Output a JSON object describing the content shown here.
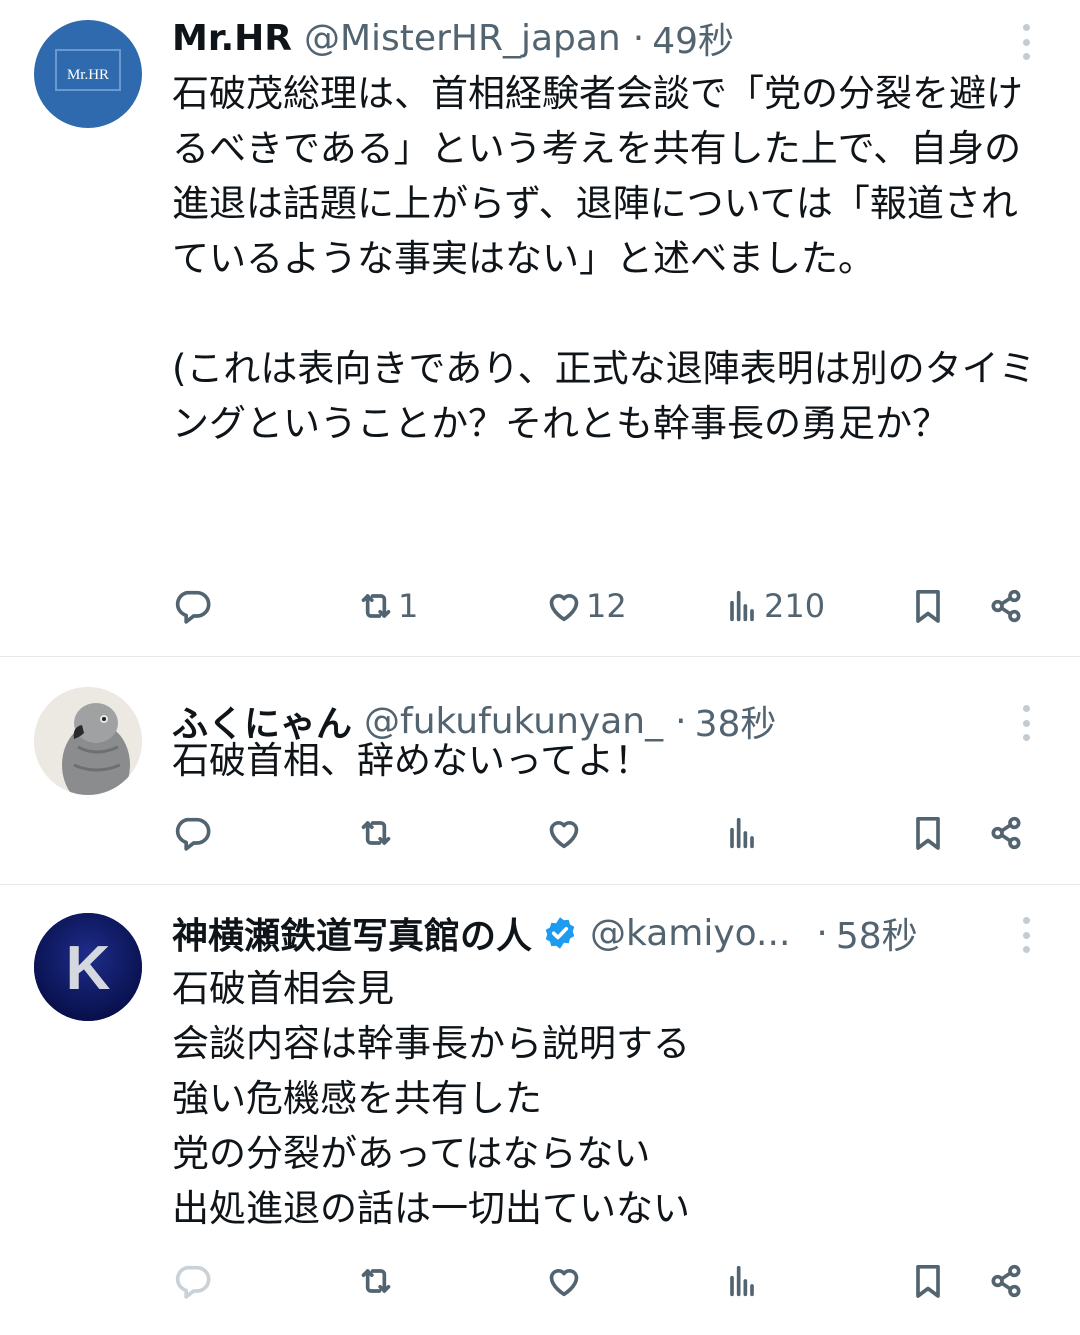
{
  "tweets": [
    {
      "avatar_text": "Mr.HR",
      "name": "Mr.HR",
      "handle": "@MisterHR_japan",
      "time": "49秒",
      "text": "石破茂総理は、首相経験者会談で「党の分裂を避けるべきである」という考えを共有した上で、自身の進退は話題に上がらず、退陣については「報道されているような事実はない」と述べました。\n\n(これは表向きであり、正式な退陣表明は別のタイミングということか？それとも幹事長の勇足か？",
      "retweets": "1",
      "likes": "12",
      "views": "210"
    },
    {
      "name": "ふくにゃん",
      "handle": "@fukufukunyan_",
      "time": "38秒",
      "text": "石破首相、辞めないってよ！",
      "retweets": "",
      "likes": "",
      "views": ""
    },
    {
      "avatar_text": "K",
      "name": "神横瀬鉄道写真館の人",
      "verified": true,
      "handle": "@kamiyo...",
      "time": "58秒",
      "text": "石破首相会見\n会談内容は幹事長から説明する\n強い危機感を共有した\n党の分裂があってはならない\n出処進退の話は一切出ていない",
      "retweets": "",
      "likes": "",
      "views": ""
    }
  ],
  "colors": {
    "text": "#0f1419",
    "secondary": "#536471",
    "divider": "#e6e9ec",
    "verified": "#1d9bf0",
    "avatar1": "#2e6aad",
    "avatar3": "#0d1a66"
  },
  "icons": [
    "reply-icon",
    "retweet-icon",
    "like-icon",
    "views-icon",
    "bookmark-icon",
    "share-icon",
    "more-icon",
    "verified-badge-icon"
  ]
}
